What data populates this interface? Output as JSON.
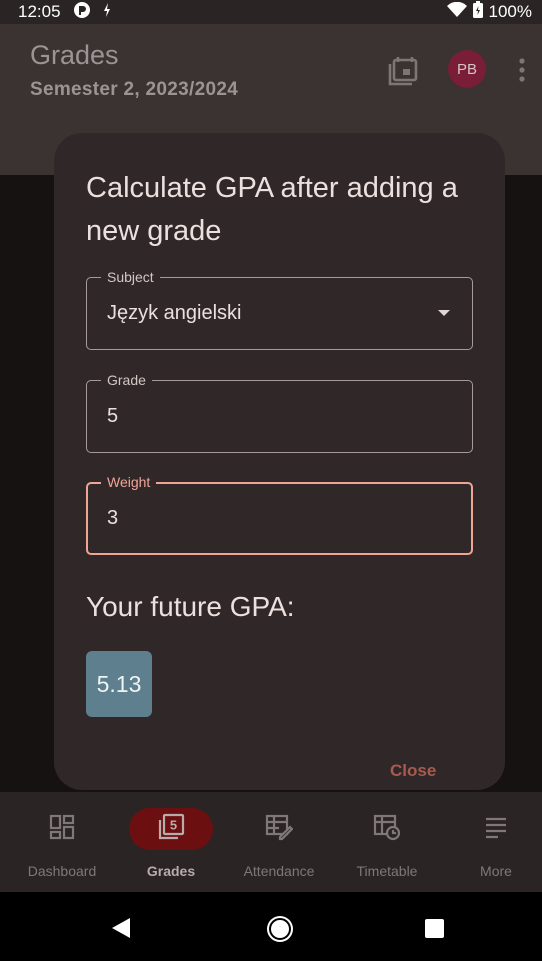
{
  "status_bar": {
    "time": "12:05",
    "battery": "100%",
    "icons": [
      "notification-icon",
      "sync-icon",
      "wifi-icon",
      "battery-icon"
    ]
  },
  "app_bar": {
    "title": "Grades",
    "subtitle": "Semester 2, 2023/2024",
    "avatar_initials": "PB",
    "avatar_color": "#7a1d37"
  },
  "dialog": {
    "title": "Calculate GPA after adding a new grade",
    "fields": {
      "subject": {
        "label": "Subject",
        "value": "Język angielski"
      },
      "grade": {
        "label": "Grade",
        "value": "5"
      },
      "weight": {
        "label": "Weight",
        "value": "3"
      }
    },
    "future_gpa_label": "Your future GPA:",
    "future_gpa_value": "5.13",
    "gpa_color": "#5e7f8d",
    "close_label": "Close",
    "focus_color": "#f0a496"
  },
  "bottom_nav": {
    "items": [
      {
        "label": "Dashboard",
        "icon": "dashboard-icon",
        "active": false
      },
      {
        "label": "Grades",
        "icon": "grades-icon",
        "active": true,
        "badge_digit": "5"
      },
      {
        "label": "Attendance",
        "icon": "attendance-icon",
        "active": false
      },
      {
        "label": "Timetable",
        "icon": "timetable-icon",
        "active": false
      },
      {
        "label": "More",
        "icon": "more-icon",
        "active": false
      }
    ]
  },
  "system_nav": [
    "back-icon",
    "home-icon",
    "recents-icon"
  ]
}
